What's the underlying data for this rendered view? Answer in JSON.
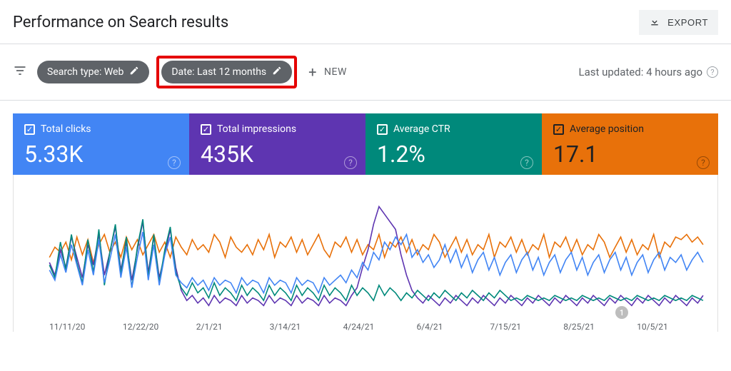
{
  "header": {
    "title": "Performance on Search results",
    "export_label": "EXPORT"
  },
  "filters": {
    "search_type": "Search type: Web",
    "date": "Date: Last 12 months",
    "new_label": "NEW",
    "updated": "Last updated: 4 hours ago"
  },
  "cards": {
    "clicks": {
      "label": "Total clicks",
      "value": "5.33K",
      "color": "#4285f4"
    },
    "impressions": {
      "label": "Total impressions",
      "value": "435K",
      "color": "#5e35b1"
    },
    "ctr": {
      "label": "Average CTR",
      "value": "1.2%",
      "color": "#00897b"
    },
    "position": {
      "label": "Average position",
      "value": "17.1",
      "color": "#e8710a"
    }
  },
  "annotation_badge": "1",
  "chart_data": {
    "type": "line",
    "x_ticks": [
      "11/11/20",
      "12/22/20",
      "2/1/21",
      "3/14/21",
      "4/24/21",
      "6/4/21",
      "7/15/21",
      "8/25/21",
      "10/5/21"
    ],
    "series": [
      {
        "name": "Average position",
        "color": "#e8710a",
        "values": [
          44,
          52,
          48,
          56,
          42,
          60,
          46,
          58,
          40,
          54,
          62,
          48,
          56,
          44,
          60,
          50,
          58,
          46,
          54,
          62,
          48,
          56,
          44,
          60,
          52,
          46,
          58,
          50,
          54,
          48,
          62,
          56,
          44,
          60,
          52,
          48,
          54,
          46,
          58,
          50,
          62,
          44,
          56,
          52,
          60,
          48,
          58,
          46,
          54,
          62,
          50,
          44,
          56,
          52,
          60,
          48,
          58,
          46,
          54,
          50,
          62,
          44,
          56,
          52,
          60,
          48,
          58,
          46,
          54,
          50,
          62,
          56,
          44,
          52,
          60,
          48,
          58,
          46,
          54,
          50,
          62,
          44,
          56,
          52,
          60,
          48,
          58,
          46,
          54,
          50,
          62,
          44,
          56,
          52,
          60,
          48,
          58,
          46,
          54,
          50,
          62,
          56,
          44,
          52,
          60,
          48,
          58,
          46,
          54,
          50,
          62,
          44,
          56,
          52,
          60,
          58,
          62,
          56,
          60,
          54
        ]
      },
      {
        "name": "Total impressions",
        "color": "#5e35b1",
        "values": [
          40,
          30,
          50,
          36,
          60,
          44,
          28,
          54,
          38,
          62,
          30,
          48,
          68,
          34,
          56,
          26,
          50,
          72,
          32,
          60,
          28,
          46,
          66,
          36,
          18,
          10,
          14,
          8,
          12,
          6,
          14,
          8,
          12,
          10,
          6,
          14,
          8,
          12,
          10,
          6,
          14,
          8,
          12,
          10,
          6,
          14,
          8,
          12,
          10,
          6,
          14,
          8,
          12,
          10,
          6,
          14,
          20,
          36,
          50,
          70,
          84,
          78,
          72,
          66,
          46,
          30,
          18,
          12,
          8,
          14,
          10,
          6,
          12,
          8,
          14,
          10,
          6,
          12,
          8,
          14,
          10,
          6,
          12,
          8,
          14,
          10,
          6,
          12,
          8,
          14,
          10,
          6,
          12,
          8,
          14,
          10,
          6,
          12,
          8,
          14,
          10,
          6,
          12,
          8,
          14,
          10,
          6,
          12,
          8,
          14,
          10,
          6,
          12,
          8,
          14,
          10,
          6,
          12,
          8,
          14
        ]
      },
      {
        "name": "Average CTR",
        "color": "#00897b",
        "values": [
          38,
          28,
          56,
          34,
          62,
          40,
          24,
          58,
          32,
          66,
          22,
          48,
          70,
          30,
          60,
          20,
          52,
          74,
          28,
          62,
          24,
          50,
          68,
          32,
          20,
          14,
          24,
          16,
          20,
          12,
          24,
          14,
          20,
          16,
          10,
          22,
          14,
          20,
          16,
          10,
          22,
          14,
          20,
          16,
          10,
          22,
          14,
          20,
          16,
          10,
          22,
          14,
          20,
          16,
          10,
          22,
          14,
          20,
          16,
          10,
          22,
          14,
          20,
          16,
          10,
          16,
          12,
          18,
          14,
          10,
          16,
          12,
          18,
          14,
          10,
          16,
          12,
          18,
          14,
          10,
          16,
          12,
          18,
          14,
          10,
          12,
          10,
          14,
          12,
          10,
          12,
          10,
          14,
          12,
          10,
          12,
          10,
          14,
          12,
          10,
          12,
          10,
          14,
          12,
          10,
          12,
          10,
          14,
          12,
          10,
          12,
          10,
          14,
          12,
          10,
          12,
          10,
          14,
          12,
          10
        ]
      },
      {
        "name": "Total clicks",
        "color": "#4285f4",
        "values": [
          34,
          26,
          46,
          32,
          54,
          38,
          22,
          50,
          30,
          58,
          24,
          42,
          62,
          28,
          52,
          20,
          44,
          64,
          26,
          54,
          22,
          46,
          60,
          30,
          24,
          20,
          28,
          22,
          26,
          18,
          28,
          22,
          26,
          24,
          16,
          28,
          22,
          26,
          24,
          16,
          28,
          22,
          26,
          24,
          16,
          28,
          22,
          26,
          24,
          16,
          28,
          22,
          26,
          30,
          24,
          34,
          28,
          40,
          34,
          48,
          42,
          56,
          50,
          60,
          54,
          62,
          44,
          50,
          40,
          46,
          36,
          42,
          54,
          40,
          50,
          36,
          46,
          32,
          42,
          48,
          34,
          44,
          30,
          40,
          46,
          32,
          42,
          48,
          34,
          44,
          30,
          40,
          46,
          32,
          42,
          48,
          34,
          44,
          30,
          40,
          46,
          32,
          42,
          48,
          34,
          44,
          30,
          40,
          46,
          32,
          42,
          48,
          34,
          44,
          40,
          46,
          34,
          42,
          48,
          40
        ]
      }
    ],
    "y_range": [
      0,
      100
    ]
  }
}
